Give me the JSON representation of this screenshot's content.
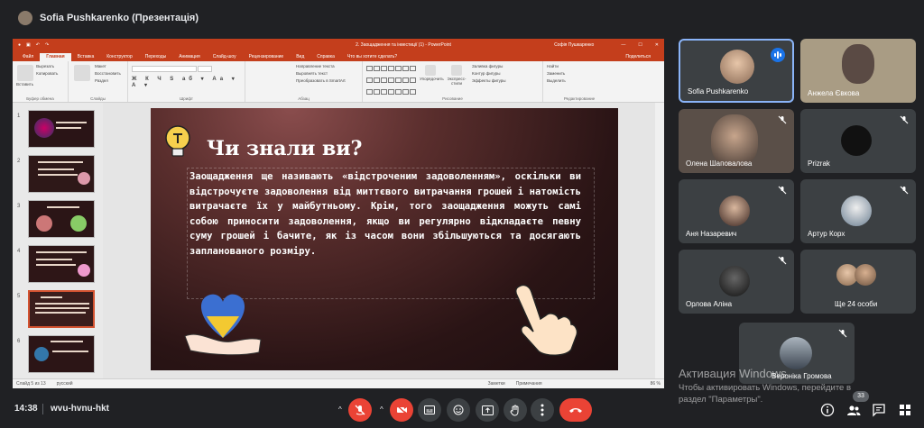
{
  "meet": {
    "presenter_banner": "Sofia Pushkarenko (Презентація)",
    "time": "14:38",
    "meeting_code": "wvu-hvnu-hkt",
    "people_count": "33"
  },
  "ppt": {
    "window_title": "2. Заощадження та інвестиції (1) - PowerPoint",
    "user": "Софія Пушкаренко",
    "tabs": [
      "Файл",
      "Главная",
      "Вставка",
      "Конструктор",
      "Переходы",
      "Анимация",
      "Слайд-шоу",
      "Рецензирование",
      "Вид",
      "Справка"
    ],
    "tell_me": "Что вы хотите сделать?",
    "share": "Поделиться",
    "ribbon": {
      "clipboard": {
        "paste": "Вставить",
        "cut": "Вырезать",
        "copy": "Копировать",
        "format": "Формат по образцу",
        "label": "Буфер обмена"
      },
      "slides": {
        "new": "Создать слайд",
        "layout": "Макет",
        "reset": "Восстановить",
        "section": "Раздел",
        "label": "Слайды"
      },
      "font": {
        "label": "Шрифт"
      },
      "paragraph": {
        "direction": "Направление текста",
        "align": "Выровнять текст",
        "smartart": "Преобразовать в SmartArt",
        "label": "Абзац"
      },
      "drawing": {
        "arrange": "Упорядочить",
        "quick_styles": "Экспресс-стили",
        "fill": "Заливка фигуры",
        "outline": "Контур фигуры",
        "effects": "Эффекты фигуры",
        "label": "Рисование"
      },
      "editing": {
        "find": "Найти",
        "replace": "Заменить",
        "select": "Выделить",
        "label": "Редактирование"
      }
    },
    "slide": {
      "title": "Чи знали ви?",
      "body": "Заощадження ще називають «відстроченим задоволенням», оскільки ви відстрочуєте задоволення від миттєвого витрачання грошей і натомість витрачаєте їх у майбутньому. Крім, того заощадження можуть самі собою приносити задоволення, якщо ви регулярно відкладаєте певну суму грошей і бачите, як із часом вони збільшуються та досягають запланованого розміру."
    },
    "thumbnail_numbers": [
      "1",
      "2",
      "3",
      "4",
      "5",
      "6"
    ],
    "status": {
      "slide": "Слайд 5 из 13",
      "lang": "русский",
      "notes": "Заметки",
      "comments": "Примечания",
      "zoom": "86 %"
    }
  },
  "participants": [
    {
      "name": "Sofia Pushkarenko",
      "speaking": true
    },
    {
      "name": "Анжела Євкова",
      "speaking": false
    },
    {
      "name": "Олена Шаповалова",
      "speaking": false
    },
    {
      "name": "Prizrak",
      "speaking": false
    },
    {
      "name": "Аня Назаревич",
      "speaking": false
    },
    {
      "name": "Артур Корх",
      "speaking": false
    },
    {
      "name": "Орлова Аліна",
      "speaking": false
    },
    {
      "name": "Ще 24 особи",
      "speaking": false
    },
    {
      "name": "Вероніка Громова",
      "speaking": false
    }
  ],
  "watermark": {
    "line1": "Активация Windows",
    "line2": "Чтобы активировать Windows, перейдите в",
    "line3": "раздел \"Параметры\"."
  },
  "colors": {
    "meet_bg": "#202124",
    "tile_bg": "#3c4043",
    "ppt_accent": "#c43e1c",
    "end_call": "#ea4335",
    "active_border": "#8ab4f8"
  }
}
